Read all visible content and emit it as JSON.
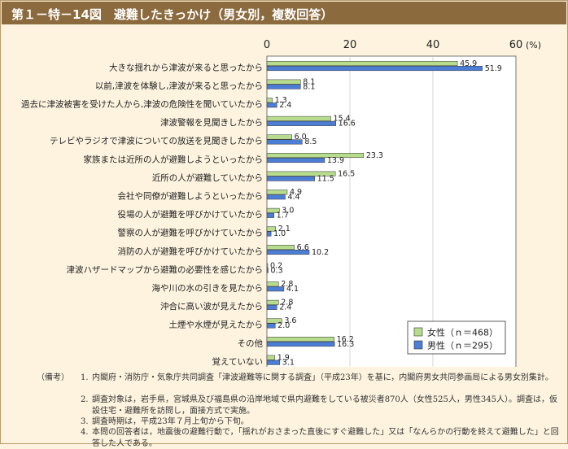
{
  "header": {
    "title": "第１－特－14図　避難したきっかけ（男女別，複数回答）"
  },
  "chart_data": {
    "type": "bar",
    "orientation": "horizontal",
    "unit_label": "(%)",
    "xlim": [
      0,
      60
    ],
    "ticks": [
      0,
      20,
      40,
      60
    ],
    "categories": [
      "大きな揺れから津波が来ると思ったから",
      "以前,津波を体験し,津波が来ると思ったから",
      "過去に津波被害を受けた人から,津波の危険性を聞いていたから",
      "津波警報を見聞きしたから",
      "テレビやラジオで津波についての放送を見聞きしたから",
      "家族または近所の人が避難しようといったから",
      "近所の人が避難していたから",
      "会社や同僚が避難しようといったから",
      "役場の人が避難を呼びかけていたから",
      "警察の人が避難を呼びかけていたから",
      "消防の人が避難を呼びかけていたから",
      "津波ハザードマップから避難の必要性を感じたから",
      "海や川の水の引きを見たから",
      "沖合に高い波が見えたから",
      "土煙や水煙が見えたから",
      "その他",
      "覚えていない"
    ],
    "series": [
      {
        "name": "女性（ｎ＝468）",
        "color": "#b7dc8e",
        "values": [
          45.9,
          8.1,
          1.3,
          15.4,
          6.0,
          23.3,
          16.5,
          4.9,
          3.0,
          2.1,
          6.6,
          0.2,
          2.8,
          2.8,
          3.6,
          16.2,
          1.9
        ],
        "labels": [
          "45.9",
          "8.1",
          "1.3",
          "15.4",
          "6.0",
          "23.3",
          "16.5",
          "4.9",
          "3.0",
          "2.1",
          "6.6",
          "0.2",
          "2.8",
          "2.8",
          "3.6",
          "16.2",
          "1.9"
        ]
      },
      {
        "name": "男性（ｎ＝295）",
        "color": "#4c7ed6",
        "values": [
          51.9,
          8.1,
          2.4,
          16.6,
          8.5,
          13.9,
          11.5,
          4.4,
          1.7,
          1.0,
          10.2,
          0.3,
          4.1,
          2.4,
          2.0,
          16.3,
          3.1
        ],
        "labels": [
          "51.9",
          "8.1",
          "2.4",
          "16.6",
          "8.5",
          "13.9",
          "11.5",
          "4.4",
          "1.7",
          "1.0",
          "10.2",
          "0.3",
          "4.1",
          "2.4",
          "2.0",
          "16.3",
          "3.1"
        ]
      }
    ],
    "legend_position": "bottom-right"
  },
  "notes": {
    "heading": "（備考）",
    "items": [
      {
        "num": "1.",
        "text": "内閣府・消防庁・気象庁共同調査「津波避難等に関する調査」（平成23年）を基に，内閣府男女共同参画局による男女別集計。"
      },
      {
        "num": "2.",
        "text": "調査対象は，岩手県，宮城県及び福島県の沿岸地域で県内避難をしている被災者870人（女性525人，男性345人）。調査は，仮設住宅・避難所を訪問し，面接方式で実施。"
      },
      {
        "num": "3.",
        "text": "調査時期は，平成23年７月上旬から下旬。"
      },
      {
        "num": "4.",
        "text": "本問の回答者は，地震後の避難行動で，「揺れがおさまった直後にすぐ避難した」又は「なんらかの行動を終えて避難した」と回答した人である。"
      }
    ]
  }
}
